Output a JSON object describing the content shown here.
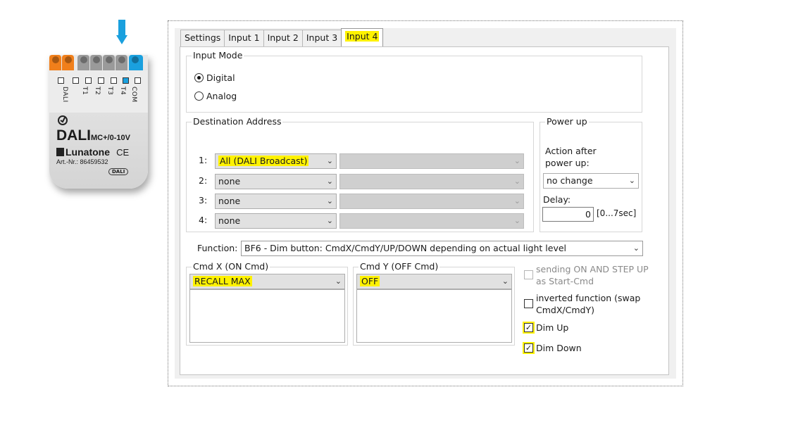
{
  "device": {
    "terminals": [
      "DALI",
      "T1",
      "T2",
      "T3",
      "T4",
      "COM"
    ],
    "model": "DALI",
    "model_suffix": "MC+/0-10V",
    "brand": "Lunatone",
    "art_nr": "Art.-Nr.: 86459532",
    "ce": "CE",
    "dali_mark": "DALI",
    "colors": {
      "orange": "#f07f1b",
      "gray": "#9a9a9a",
      "blue": "#1aa0de",
      "highlight": "#fff200"
    }
  },
  "tabs": [
    {
      "label": "Settings"
    },
    {
      "label": "Input 1"
    },
    {
      "label": "Input 2"
    },
    {
      "label": "Input 3"
    },
    {
      "label": "Input 4"
    }
  ],
  "input_mode": {
    "title": "Input Mode",
    "options": [
      "Digital",
      "Analog"
    ],
    "selected": "Digital"
  },
  "destination": {
    "title": "Destination Address",
    "rows": [
      {
        "label": "1:",
        "value": "All (DALI Broadcast)"
      },
      {
        "label": "2:",
        "value": "none"
      },
      {
        "label": "3:",
        "value": "none"
      },
      {
        "label": "4:",
        "value": "none"
      }
    ]
  },
  "power_up": {
    "title": "Power up",
    "action_label_1": "Action after",
    "action_label_2": "power up:",
    "action_value": "no change",
    "delay_label": "Delay:",
    "delay_value": "0",
    "delay_range": "[0...7sec]"
  },
  "function": {
    "label": "Function:",
    "value": "BF6 - Dim button:  CmdX/CmdY/UP/DOWN depending on actual light level"
  },
  "cmd_x": {
    "title": "Cmd X  (ON Cmd)",
    "value": "RECALL MAX"
  },
  "cmd_y": {
    "title": "Cmd Y  (OFF Cmd)",
    "value": "OFF"
  },
  "options": {
    "sending_1": "sending ON AND STEP UP",
    "sending_2": "as Start-Cmd",
    "inverted_1": "inverted function (swap",
    "inverted_2": "CmdX/CmdY)",
    "dim_up": "Dim Up",
    "dim_down": "Dim Down",
    "dim_up_checked": true,
    "dim_down_checked": true
  }
}
